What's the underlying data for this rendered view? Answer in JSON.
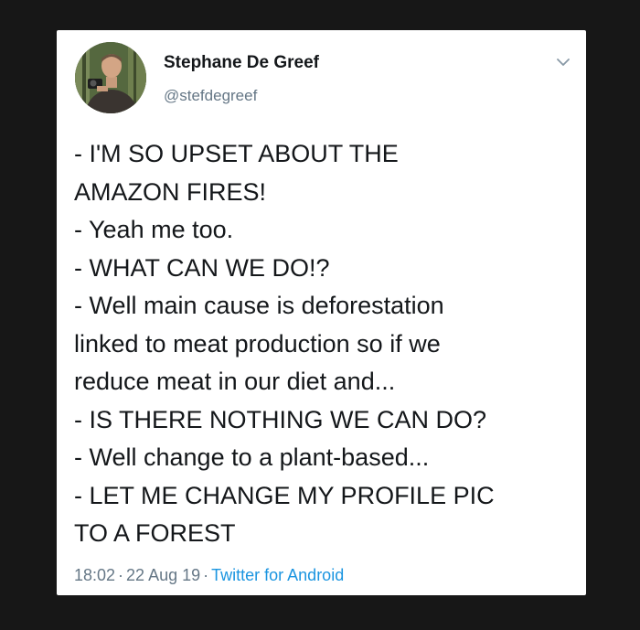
{
  "author": {
    "display_name": "Stephane De Greef",
    "handle": "@stefdegreef",
    "avatar_icon": "profile-photo"
  },
  "menu_icon": "chevron-down-icon",
  "tweet": {
    "lines": [
      "- I'M SO UPSET ABOUT THE",
      "AMAZON FIRES!",
      "- Yeah me too.",
      "- WHAT CAN WE DO!?",
      "- Well main cause is deforestation",
      "linked to meat production so if we",
      "reduce meat in our diet and...",
      "- IS THERE NOTHING WE CAN DO?",
      "- Well change to a plant-based...",
      "- LET ME CHANGE MY PROFILE PIC",
      "TO A FOREST"
    ]
  },
  "meta": {
    "time": "18:02",
    "date": "22 Aug 19",
    "separator": "·",
    "source": "Twitter for Android"
  },
  "colors": {
    "background": "#171717",
    "card": "#ffffff",
    "text": "#14171a",
    "secondary": "#657786",
    "link": "#1b95e0"
  }
}
